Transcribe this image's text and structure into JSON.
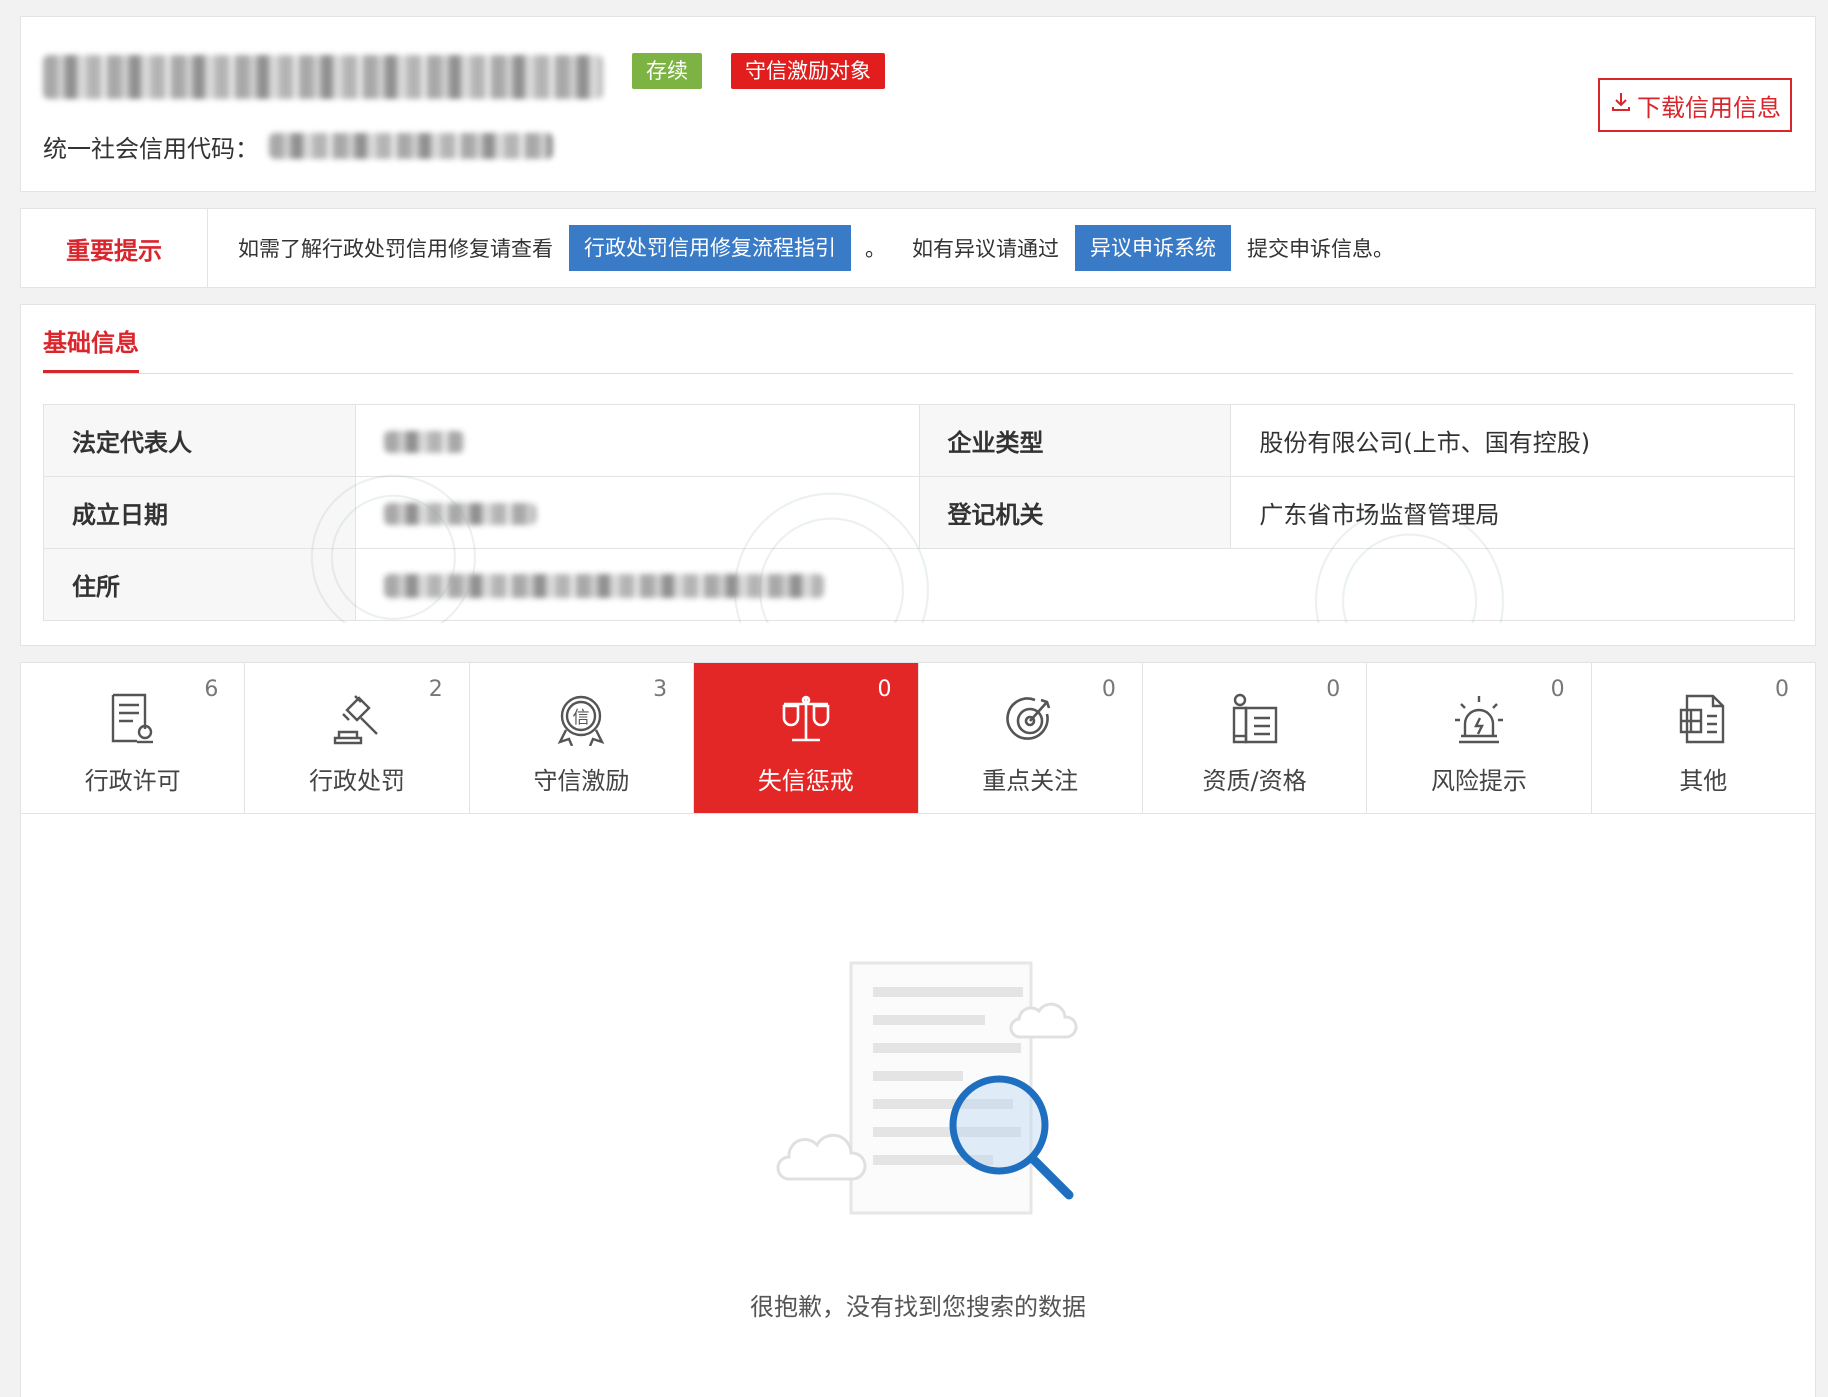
{
  "header": {
    "company_name": "",
    "status_tag": "存续",
    "credit_tag": "守信激励对象",
    "code_label": "统一社会信用代码：",
    "download_label": "下载信用信息"
  },
  "notice": {
    "title": "重要提示",
    "text1": "如需了解行政处罚信用修复请查看",
    "button1": "行政处罚信用修复流程指引",
    "text2": "。",
    "text3": "如有异议请通过",
    "button2": "异议申诉系统",
    "text4": "提交申诉信息。"
  },
  "basic": {
    "tab": "基础信息",
    "rows": [
      {
        "k1": "法定代表人",
        "v1": "",
        "k2": "企业类型",
        "v2": "股份有限公司(上市、国有控股)"
      },
      {
        "k1": "成立日期",
        "v1": "",
        "k2": "登记机关",
        "v2": "广东省市场监督管理局"
      },
      {
        "k1": "住所",
        "v1": ""
      }
    ]
  },
  "categories": [
    {
      "label": "行政许可",
      "count": "6",
      "icon": "permit-document-icon",
      "active": false
    },
    {
      "label": "行政处罚",
      "count": "2",
      "icon": "gavel-icon",
      "active": false
    },
    {
      "label": "守信激励",
      "count": "3",
      "icon": "credit-badge-icon",
      "active": false
    },
    {
      "label": "失信惩戒",
      "count": "0",
      "icon": "scales-icon",
      "active": true
    },
    {
      "label": "重点关注",
      "count": "0",
      "icon": "target-icon",
      "active": false
    },
    {
      "label": "资质/资格",
      "count": "0",
      "icon": "certificate-icon",
      "active": false
    },
    {
      "label": "风险提示",
      "count": "0",
      "icon": "alarm-light-icon",
      "active": false
    },
    {
      "label": "其他",
      "count": "0",
      "icon": "grid-document-icon",
      "active": false
    }
  ],
  "empty": {
    "message": "很抱歉，没有找到您搜索的数据"
  },
  "colors": {
    "accent_red": "#e21d1d",
    "status_green": "#7cb342",
    "button_blue": "#3a7bc8"
  }
}
